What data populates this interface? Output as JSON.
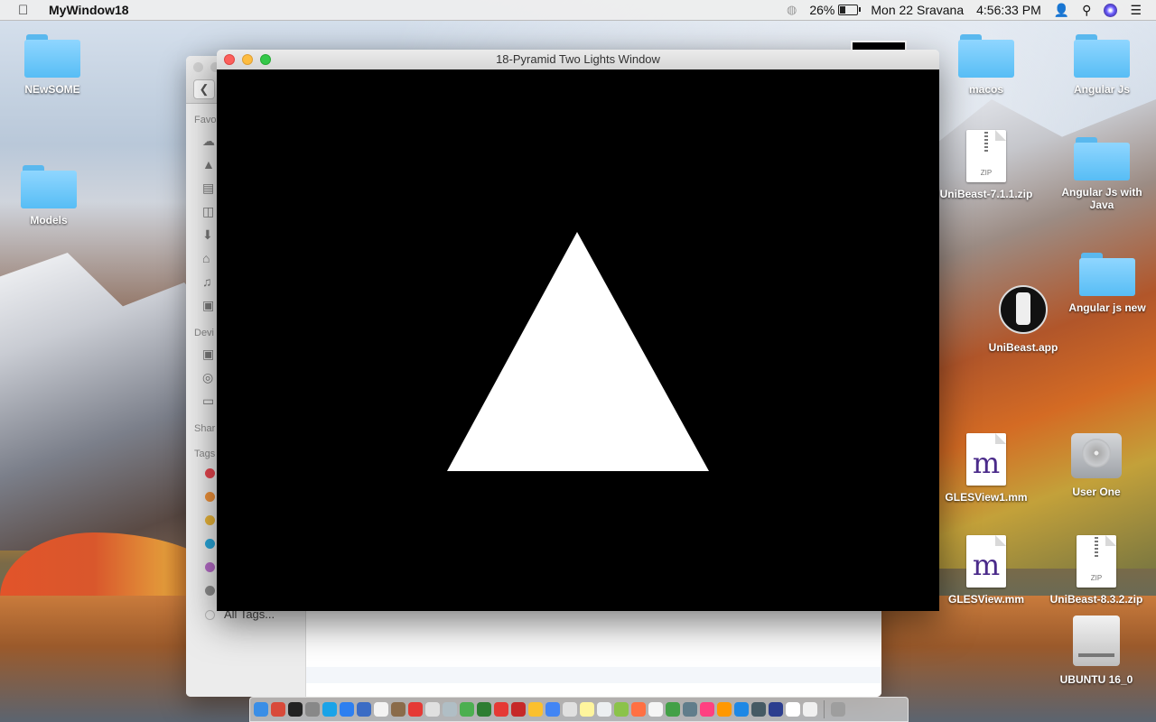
{
  "menubar": {
    "app_name": "MyWindow18",
    "battery_percent": "26%",
    "datetime": "Mon 22 Sravana",
    "time": "4:56:33 PM",
    "icons": [
      "apple-icon",
      "wifi-icon",
      "battery-icon",
      "user-icon",
      "spotlight-icon",
      "siri-icon",
      "notification-center-icon"
    ]
  },
  "gl_window": {
    "title": "18-Pyramid Two Lights Window"
  },
  "finder": {
    "sidebar_sections": [
      "Favo",
      "Devi",
      "Shar",
      "Tags"
    ],
    "all_tags_label": "All Tags...",
    "tag_colors": [
      "#e8464f",
      "#f0923a",
      "#eab53a",
      "#2aa8dc",
      "#b66cc8",
      "#8d8d8d"
    ]
  },
  "desktop_icons": {
    "newsome": "NEwSOME",
    "models": "Models",
    "macos": "macos",
    "angular_js": "Angular Js",
    "unibeast_zip_1": "UniBeast-7.1.1.zip",
    "angular_js_java": "Angular Js with Java",
    "angular_js_new": "Angular js new",
    "unibeast_app": "UniBeast.app",
    "glesview1": "GLESView1.mm",
    "user_one": "User One",
    "glesview": "GLESView.mm",
    "unibeast_zip_2": "UniBeast-8.3.2.zip",
    "ubuntu": "UBUNTU 16_0"
  },
  "dock": {
    "app_colors": [
      "#3a8ee6",
      "#d84a3a",
      "#222",
      "#888",
      "#1aa3e8",
      "#2d7ff0",
      "#3b6cc5",
      "#f3f3f3",
      "#8a6b4a",
      "#e53935",
      "#e0e0e0",
      "#b0bec5",
      "#4caf50",
      "#2e7d32",
      "#e53935",
      "#c62828",
      "#fbc02d",
      "#4285f4",
      "#e0e0e0",
      "#fff59d",
      "#eceff1",
      "#8bc34a",
      "#ff7043",
      "#f5f5f5",
      "#43a047",
      "#607d8b",
      "#ff4081",
      "#ff9800",
      "#1e88e5",
      "#455a64",
      "#2c3e8f",
      "#ffffff",
      "#f0f0f0",
      "#9e9e9e"
    ]
  }
}
